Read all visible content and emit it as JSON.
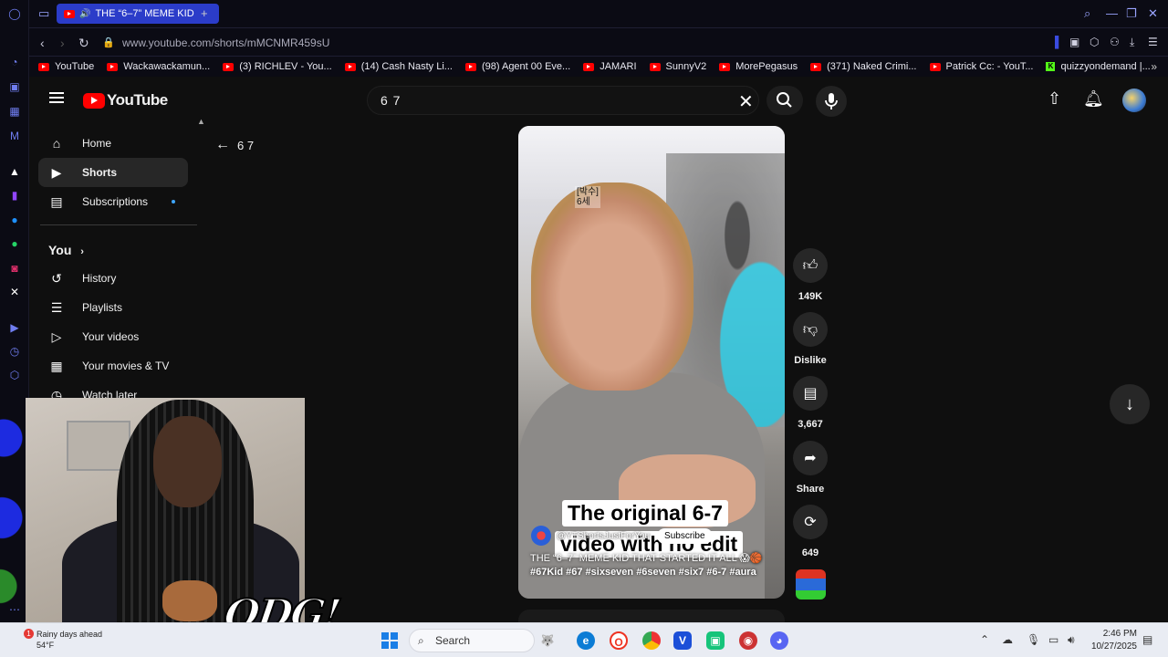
{
  "browser": {
    "tab_title": "THE “6–7” MEME KID",
    "url": "www.youtube.com/shorts/mMCNMR459sU",
    "bookmarks": [
      {
        "label": "YouTube",
        "icon": "youtube-icon"
      },
      {
        "label": "Wackawackamun...",
        "icon": "youtube-icon"
      },
      {
        "label": "(3) RICHLEV - You...",
        "icon": "youtube-icon"
      },
      {
        "label": "(14) Cash Nasty Li...",
        "icon": "youtube-icon"
      },
      {
        "label": "(98) Agent 00 Eve...",
        "icon": "youtube-icon"
      },
      {
        "label": "JAMARI",
        "icon": "youtube-icon"
      },
      {
        "label": "SunnyV2",
        "icon": "youtube-icon"
      },
      {
        "label": "MorePegasus",
        "icon": "youtube-icon"
      },
      {
        "label": "(371) Naked Crimi...",
        "icon": "youtube-icon"
      },
      {
        "label": "Patrick Cc: - YouT...",
        "icon": "youtube-icon"
      },
      {
        "label": "quizzyondemand |...",
        "icon": "kick-icon"
      }
    ]
  },
  "youtube": {
    "logo_text": "YouTube",
    "search_query": "6 7",
    "sidebar": {
      "items": [
        {
          "label": "Home",
          "icon": "home-icon"
        },
        {
          "label": "Shorts",
          "icon": "shorts-icon"
        },
        {
          "label": "Subscriptions",
          "icon": "subscriptions-icon"
        }
      ],
      "you_label": "You",
      "you_items": [
        {
          "label": "History",
          "icon": "history-icon"
        },
        {
          "label": "Playlists",
          "icon": "playlists-icon"
        },
        {
          "label": "Your videos",
          "icon": "your-videos-icon"
        },
        {
          "label": "Your movies & TV",
          "icon": "movies-icon"
        },
        {
          "label": "Watch later",
          "icon": "watch-later-icon"
        }
      ]
    },
    "back_query": "6 7",
    "short": {
      "overlay_korean_1": "[박수]",
      "overlay_korean_2": "6세",
      "caption_line1": "The original 6-7",
      "caption_line2": "video with no edit",
      "channel": "@YTShortsJustForYou",
      "subscribe": "Subscribe",
      "title": "THE “6–7” MEME KID THAT STARTED IT ALL 😱🏀",
      "hashtags": "#67Kid #67 #sixseven #6seven #six7 #6-7 #aura"
    },
    "actions": {
      "likes": "149K",
      "dislike": "Dislike",
      "comments": "3,667",
      "share": "Share",
      "remix": "649"
    }
  },
  "taskbar": {
    "weather_line1": "Rainy days ahead",
    "weather_line2": "54°F",
    "weather_badge": "1",
    "search_label": "Search",
    "time": "2:46 PM",
    "date": "10/27/2025"
  },
  "overlay": {
    "logo_text": "ODG!"
  },
  "colors": {
    "tab_active": "#2b3cc9",
    "youtube_red": "#ff0000",
    "background": "#0f0f0f",
    "subscription_dot": "#3ea6ff"
  }
}
